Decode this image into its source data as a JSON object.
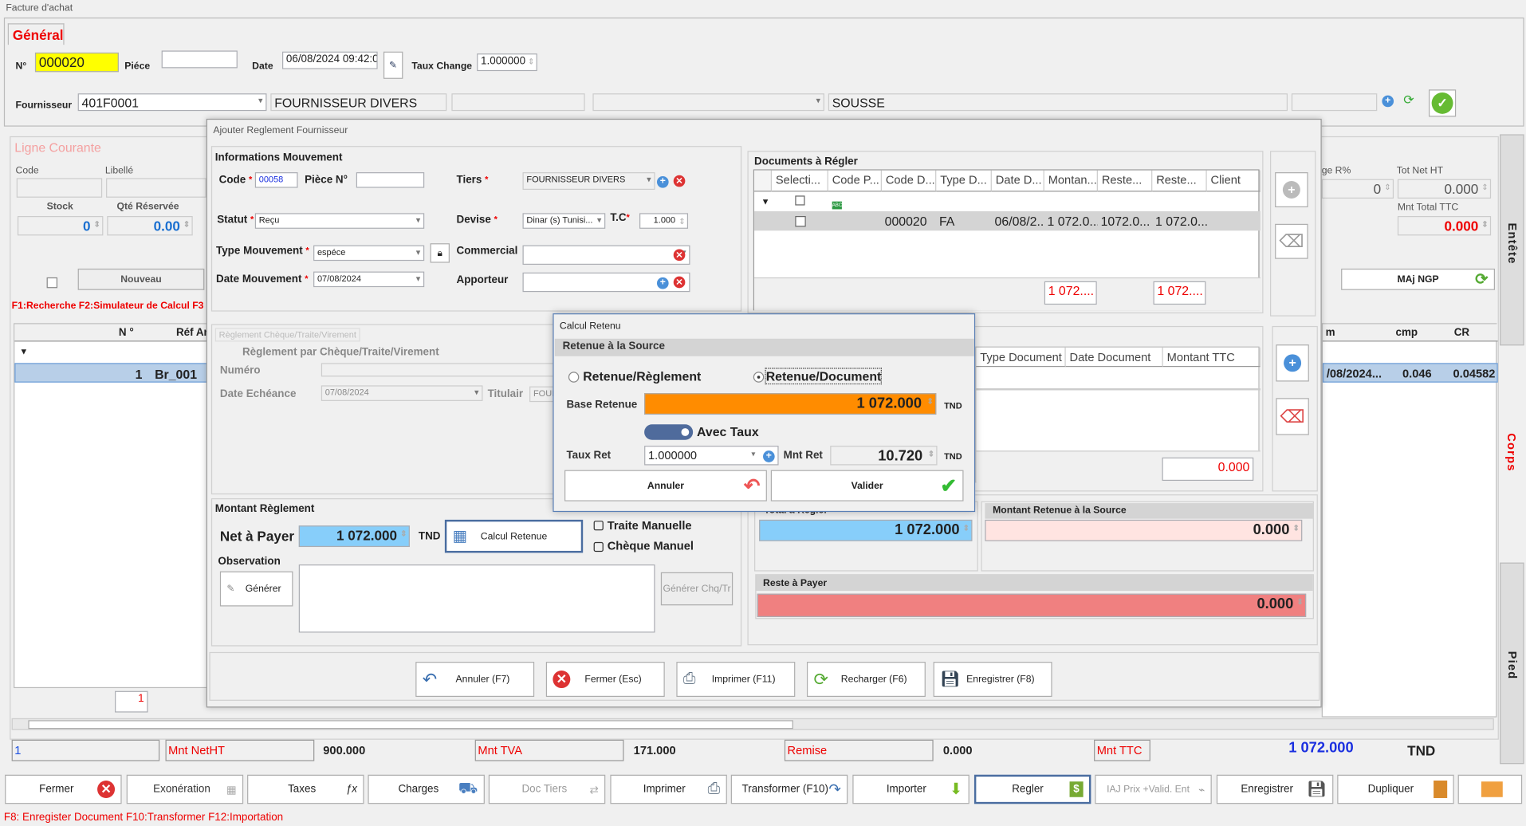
{
  "window": {
    "title": "Facture d'achat"
  },
  "general": {
    "tab": "Général",
    "num_label": "N°",
    "num": "000020",
    "piece_label": "Piéce",
    "piece": "",
    "date_label": "Date",
    "date": "06/08/2024 09:42:0",
    "taux_label": "Taux Change",
    "taux": "1.000000",
    "fourn_label": "Fournisseur",
    "fourn_code": "401F0001",
    "fourn_name": "FOURNISSEUR DIVERS",
    "ville": "SOUSSE"
  },
  "ligne": {
    "title": "Ligne Courante",
    "code_label": "Code",
    "libelle_label": "Libellé",
    "stock_label": "Stock",
    "stock": "0",
    "qte_label": "Qté Réservée",
    "qte": "0.00",
    "nouveau": "Nouveau",
    "shortcuts": "F1:Recherche   F2:Simulateur de Calcul   F3",
    "page": "1"
  },
  "left_grid": {
    "headers": [
      "N °",
      "Réf Ar"
    ],
    "row": {
      "n": "1",
      "ref": "Br_001"
    }
  },
  "right_panel": {
    "remise_label": "ge R%",
    "remise": "0",
    "totnet_label": "Tot Net HT",
    "totnet": "0.000",
    "mnttotal_label": "Mnt Total  TTC",
    "mnttotal": "0.000",
    "majngp": "MAj NGP",
    "grid_headers": [
      "m",
      "cmp",
      "CR"
    ],
    "row": [
      "/08/2024...",
      "0.046",
      "0.04582"
    ]
  },
  "side_tabs": {
    "entete": "Entête",
    "corps": "Corps",
    "pied": "Pied"
  },
  "totals": {
    "count": "1",
    "netht_label": "Mnt NetHT",
    "netht": "900.000",
    "tva_label": "Mnt TVA",
    "tva": "171.000",
    "remise_label": "Remise",
    "remise": "0.000",
    "ttc_label": "Mnt TTC",
    "ttc": "1 072.000",
    "currency": "TND"
  },
  "toolbar": [
    "Fermer",
    "Exonération",
    "Taxes",
    "Charges",
    "Doc Tiers",
    "Imprimer",
    "Transformer (F10)",
    "Importer",
    "Regler",
    "IAJ Prix +Valid. Ent",
    "Enregistrer",
    "Dupliquer"
  ],
  "footer_shortcuts": "F8: Enregister Document   F10:Transformer   F12:Importation",
  "reglement": {
    "title": "Ajouter Reglement Fournisseur",
    "info": {
      "heading": "Informations Mouvement",
      "code_label": "Code",
      "code": "00058",
      "piece_label": "Pièce N°",
      "piece": "",
      "tiers_label": "Tiers",
      "tiers": "FOURNISSEUR DIVERS",
      "statut_label": "Statut",
      "statut": "Reçu",
      "devise_label": "Devise",
      "devise": "Dinar (s) Tunisi...",
      "tc_label": "T.C",
      "tc": "1.000",
      "type_label": "Type Mouvement",
      "type": "espéce",
      "commercial_label": "Commercial",
      "datemvt_label": "Date Mouvement",
      "datemvt": "07/08/2024",
      "apporteur_label": "Apporteur"
    },
    "docs": {
      "heading": "Documents à Régler",
      "headers": [
        "Selecti...",
        "Code P...",
        "Code D...",
        "Type D...",
        "Date D...",
        "Montan...",
        "Reste...",
        "Reste...",
        "Client"
      ],
      "row": [
        "",
        "",
        "000020",
        "FA",
        "06/08/2...",
        "1 072.0...",
        "1072.0...",
        "1 072.0...",
        ""
      ],
      "sum1": "1 072....",
      "sum2": "1 072...."
    },
    "cheque": {
      "tab": "Règlement Chèque/Traite/Virement",
      "heading": "Règlement par Chèque/Traite/Virement",
      "numero_label": "Numéro",
      "echeance_label": "Date Echéance",
      "echeance": "07/08/2024",
      "titulaire_label": "Titulair",
      "titulaire": "FOUR"
    },
    "retenues": {
      "headers": [
        "Type Document",
        "Date Document",
        "Montant TTC"
      ],
      "total": "0.000"
    },
    "montant": {
      "heading": "Montant Règlement",
      "net_label": "Net à Payer",
      "net": "1 072.000",
      "currency": "TND",
      "calcul": "Calcul Retenue",
      "traite": "Traite Manuelle",
      "cheque": "Chèque Manuel",
      "obs_label": "Observation",
      "generer": "Générer",
      "generer_chq": "Générer Chq/Tr"
    },
    "total_regler": {
      "heading": "Total à Régler",
      "value": "1 072.000"
    },
    "retenue_source": {
      "heading": "Montant Retenue à la Source",
      "value": "0.000"
    },
    "reste": {
      "heading": "Reste à Payer",
      "value": "0.000"
    },
    "buttons": [
      "Annuler (F7)",
      "Fermer (Esc)",
      "Imprimer (F11)",
      "Recharger (F6)",
      "Enregistrer (F8)"
    ]
  },
  "calcul": {
    "title": "Calcul Retenu",
    "heading": "Retenue à la Source",
    "radio1": "Retenue/Règlement",
    "radio2": "Retenue/Document",
    "selected": "Retenue/Document",
    "base_label": "Base Retenue",
    "base": "1 072.000",
    "currency": "TND",
    "toggle_label": "Avec Taux",
    "toggle_on": true,
    "taux_label": "Taux Ret",
    "taux": "1.000000",
    "mnt_label": "Mnt Ret",
    "mnt": "10.720",
    "annuler": "Annuler",
    "valider": "Valider"
  },
  "colors": {
    "accent_red": "#e00000",
    "yellow": "#ffff00",
    "orange": "#ff8c00",
    "light_blue": "#87cefa",
    "pink": "#ffe4e1",
    "salmon": "#f08080",
    "selected_row": "#b8cfe8"
  }
}
